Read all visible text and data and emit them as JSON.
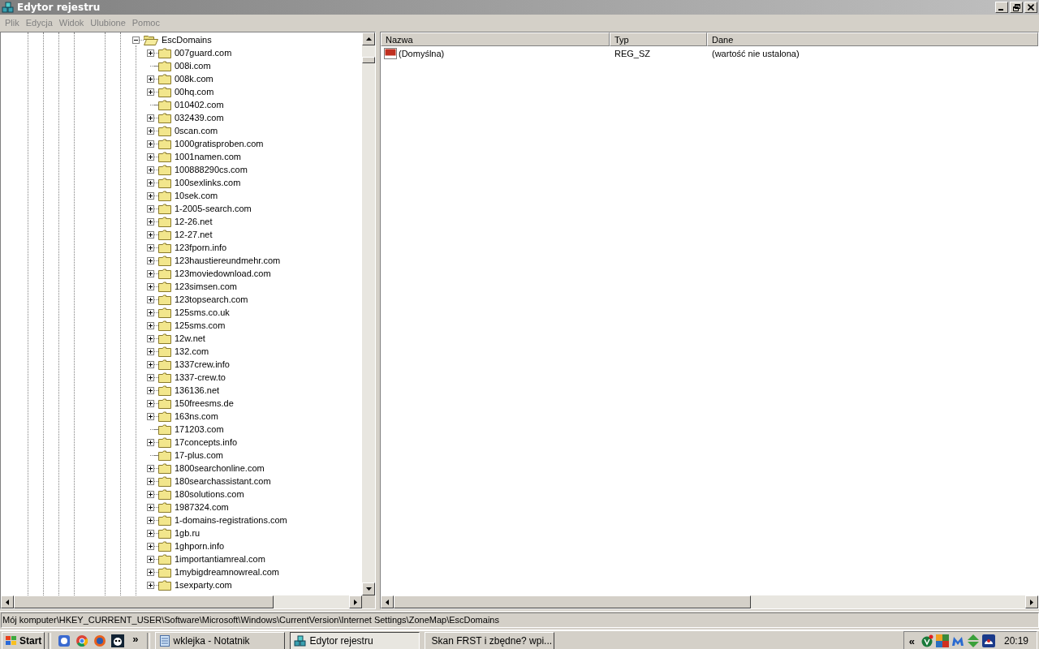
{
  "window": {
    "title": "Edytor rejestru",
    "active": false
  },
  "menu": [
    "Plik",
    "Edycja",
    "Widok",
    "Ulubione",
    "Pomoc"
  ],
  "tree": {
    "root": {
      "label": "EscDomains",
      "expanded": true,
      "children": [
        {
          "label": "007guard.com",
          "expandable": true
        },
        {
          "label": "008i.com",
          "expandable": false
        },
        {
          "label": "008k.com",
          "expandable": true
        },
        {
          "label": "00hq.com",
          "expandable": true
        },
        {
          "label": "010402.com",
          "expandable": false
        },
        {
          "label": "032439.com",
          "expandable": true
        },
        {
          "label": "0scan.com",
          "expandable": true
        },
        {
          "label": "1000gratisproben.com",
          "expandable": true
        },
        {
          "label": "1001namen.com",
          "expandable": true
        },
        {
          "label": "100888290cs.com",
          "expandable": true
        },
        {
          "label": "100sexlinks.com",
          "expandable": true
        },
        {
          "label": "10sek.com",
          "expandable": true
        },
        {
          "label": "1-2005-search.com",
          "expandable": true
        },
        {
          "label": "12-26.net",
          "expandable": true
        },
        {
          "label": "12-27.net",
          "expandable": true
        },
        {
          "label": "123fporn.info",
          "expandable": true
        },
        {
          "label": "123haustiereundmehr.com",
          "expandable": true
        },
        {
          "label": "123moviedownload.com",
          "expandable": true
        },
        {
          "label": "123simsen.com",
          "expandable": true
        },
        {
          "label": "123topsearch.com",
          "expandable": true
        },
        {
          "label": "125sms.co.uk",
          "expandable": true
        },
        {
          "label": "125sms.com",
          "expandable": true
        },
        {
          "label": "12w.net",
          "expandable": true
        },
        {
          "label": "132.com",
          "expandable": true
        },
        {
          "label": "1337crew.info",
          "expandable": true
        },
        {
          "label": "1337-crew.to",
          "expandable": true
        },
        {
          "label": "136136.net",
          "expandable": true
        },
        {
          "label": "150freesms.de",
          "expandable": true
        },
        {
          "label": "163ns.com",
          "expandable": true
        },
        {
          "label": "171203.com",
          "expandable": false
        },
        {
          "label": "17concepts.info",
          "expandable": true
        },
        {
          "label": "17-plus.com",
          "expandable": false
        },
        {
          "label": "1800searchonline.com",
          "expandable": true
        },
        {
          "label": "180searchassistant.com",
          "expandable": true
        },
        {
          "label": "180solutions.com",
          "expandable": true
        },
        {
          "label": "1987324.com",
          "expandable": true
        },
        {
          "label": "1-domains-registrations.com",
          "expandable": true
        },
        {
          "label": "1gb.ru",
          "expandable": true
        },
        {
          "label": "1ghporn.info",
          "expandable": true
        },
        {
          "label": "1importantiamreal.com",
          "expandable": true
        },
        {
          "label": "1mybigdreamnowreal.com",
          "expandable": true
        },
        {
          "label": "1sexparty.com",
          "expandable": true
        }
      ]
    }
  },
  "values": {
    "columns": [
      "Nazwa",
      "Typ",
      "Dane"
    ],
    "rows": [
      {
        "name": "(Domyślna)",
        "type": "REG_SZ",
        "data": "(wartość nie ustalona)"
      }
    ]
  },
  "status_bar": "Mój komputer\\HKEY_CURRENT_USER\\Software\\Microsoft\\Windows\\CurrentVersion\\Internet Settings\\ZoneMap\\EscDomains",
  "taskbar": {
    "start": "Start",
    "more": "»",
    "tasks": [
      {
        "label": "wklejka - Notatnik",
        "kind": "notepad",
        "selected": false
      },
      {
        "label": "Edytor rejestru",
        "kind": "regedit",
        "selected": true
      },
      {
        "label": "Skan FRST i zbędne? wpi...",
        "kind": "browser",
        "selected": false
      }
    ],
    "tray_expand": "«",
    "clock": "20:19"
  }
}
